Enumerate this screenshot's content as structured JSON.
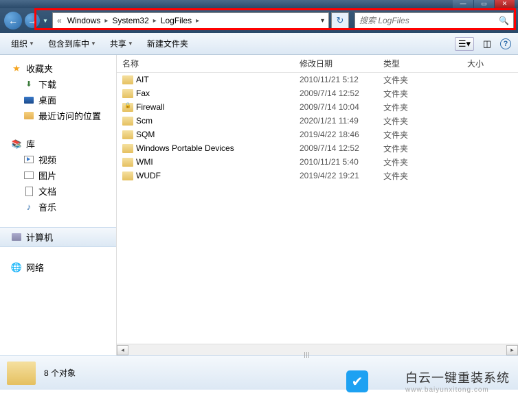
{
  "breadcrumbs": [
    "Windows",
    "System32",
    "LogFiles"
  ],
  "search": {
    "placeholder": "搜索 LogFiles"
  },
  "toolbar": {
    "organize": "组织",
    "include": "包含到库中",
    "share": "共享",
    "newfolder": "新建文件夹"
  },
  "nav": {
    "favorites": "收藏夹",
    "downloads": "下载",
    "desktop": "桌面",
    "recent": "最近访问的位置",
    "libraries": "库",
    "videos": "视频",
    "pictures": "图片",
    "documents": "文档",
    "music": "音乐",
    "computer": "计算机",
    "network": "网络"
  },
  "columns": {
    "name": "名称",
    "date": "修改日期",
    "type": "类型",
    "size": "大小"
  },
  "rows": [
    {
      "name": "AIT",
      "date": "2010/11/21 5:12",
      "type": "文件夹",
      "locked": false
    },
    {
      "name": "Fax",
      "date": "2009/7/14 12:52",
      "type": "文件夹",
      "locked": false
    },
    {
      "name": "Firewall",
      "date": "2009/7/14 10:04",
      "type": "文件夹",
      "locked": true
    },
    {
      "name": "Scm",
      "date": "2020/1/21 11:49",
      "type": "文件夹",
      "locked": false
    },
    {
      "name": "SQM",
      "date": "2019/4/22 18:46",
      "type": "文件夹",
      "locked": false
    },
    {
      "name": "Windows Portable Devices",
      "date": "2009/7/14 12:52",
      "type": "文件夹",
      "locked": false
    },
    {
      "name": "WMI",
      "date": "2010/11/21 5:40",
      "type": "文件夹",
      "locked": false
    },
    {
      "name": "WUDF",
      "date": "2019/4/22 19:21",
      "type": "文件夹",
      "locked": false
    }
  ],
  "status": {
    "count": "8 个对象"
  },
  "watermark": {
    "title": "白云一键重装系统",
    "url": "www.baiyunxitong.com"
  }
}
